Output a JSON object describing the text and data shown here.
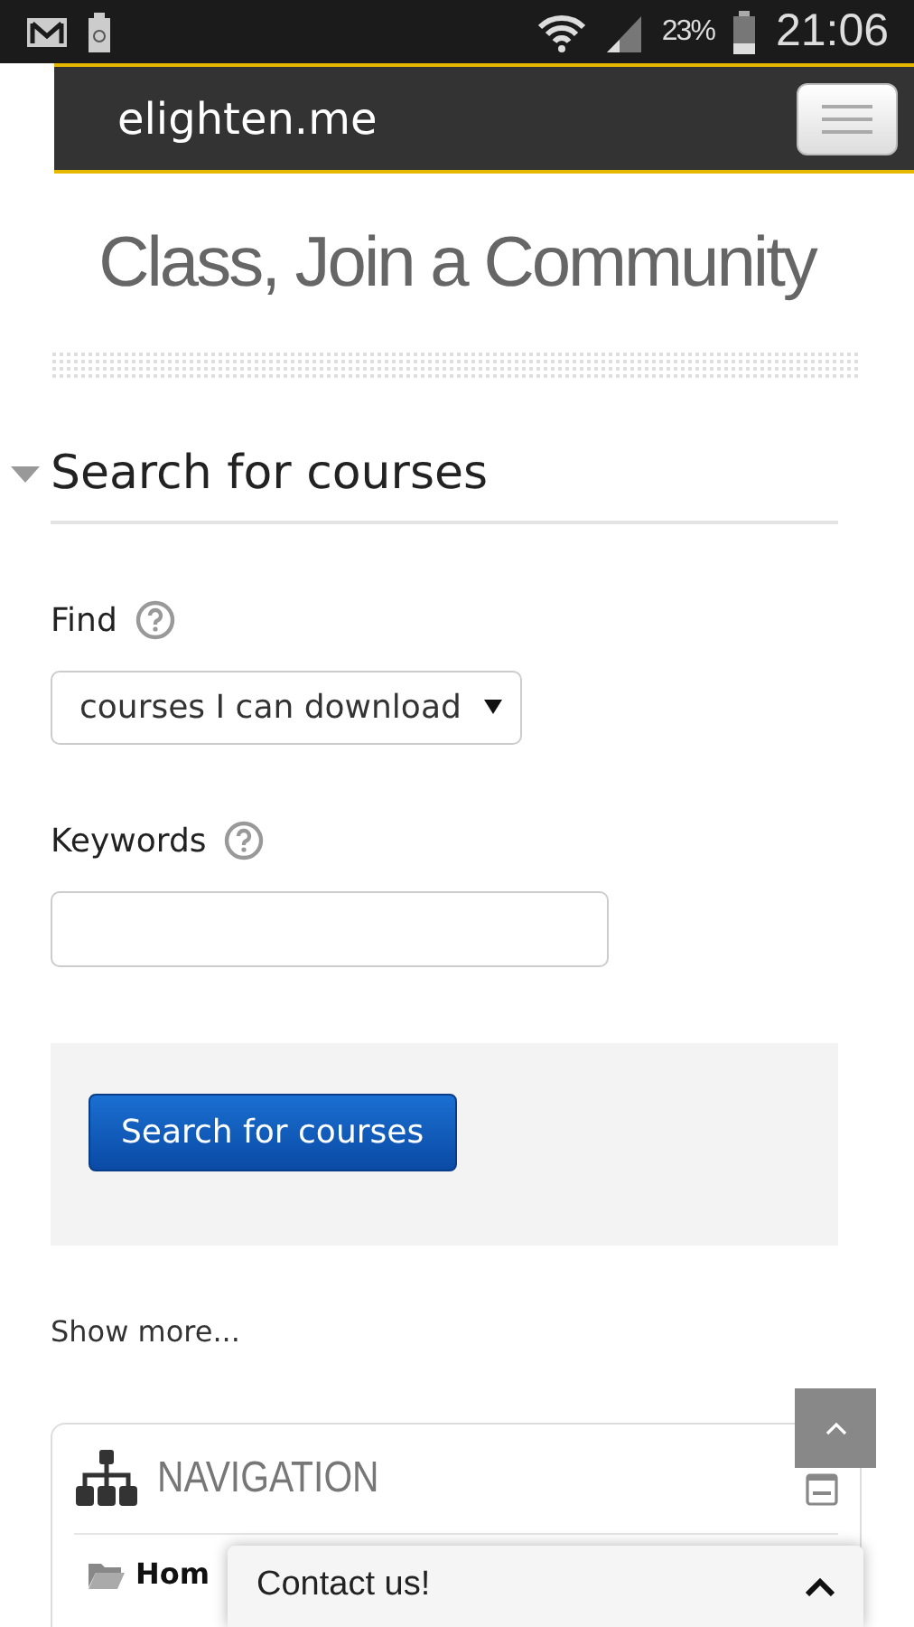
{
  "status_bar": {
    "battery": "23%",
    "time": "21:06"
  },
  "navbar": {
    "brand": "elighten.me"
  },
  "headline": "Class, Join a Community",
  "search_section": {
    "title": "Search for courses",
    "expanded": true,
    "fields": [
      {
        "kind": "select",
        "label": "Find",
        "value": "courses I can download"
      },
      {
        "kind": "text",
        "label": "Keywords"
      }
    ],
    "button": "Search for courses"
  },
  "show_more": "Show more...",
  "navigation_block": {
    "title": "NAVIGATION",
    "items": [
      {
        "label": "Hom"
      }
    ]
  },
  "contact": {
    "label": "Contact us!"
  }
}
